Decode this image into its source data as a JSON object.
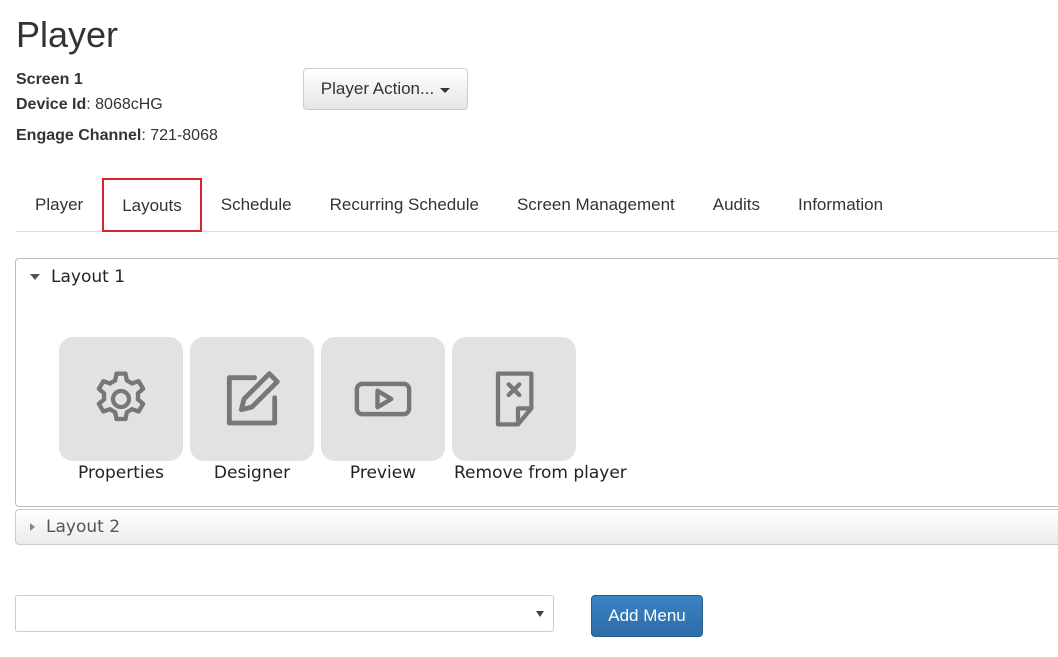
{
  "page": {
    "title": "Player"
  },
  "info": {
    "screen": "Screen 1",
    "device_label": "Device Id",
    "device_value": ": 8068cHG",
    "channel_label": "Engage Channel",
    "channel_value": ": 721-8068"
  },
  "actions": {
    "player_action_label": "Player Action..."
  },
  "tabs": [
    {
      "label": "Player"
    },
    {
      "label": "Layouts",
      "active": true
    },
    {
      "label": "Schedule"
    },
    {
      "label": "Recurring Schedule"
    },
    {
      "label": "Screen Management"
    },
    {
      "label": "Audits"
    },
    {
      "label": "Information"
    }
  ],
  "layouts": [
    {
      "title": "Layout 1",
      "expanded": true,
      "tiles": [
        {
          "label": "Properties",
          "icon": "gear-icon"
        },
        {
          "label": "Designer",
          "icon": "edit-icon"
        },
        {
          "label": "Preview",
          "icon": "play-icon"
        },
        {
          "label": "Remove from player",
          "icon": "remove-file-icon"
        }
      ]
    },
    {
      "title": "Layout 2",
      "expanded": false
    }
  ],
  "footer": {
    "select_value": "",
    "add_menu_label": "Add Menu"
  },
  "colors": {
    "active_tab_border": "#d9232a",
    "primary_button": "#337ab7",
    "tile_bg": "#e2e2e2",
    "icon": "#777777"
  }
}
